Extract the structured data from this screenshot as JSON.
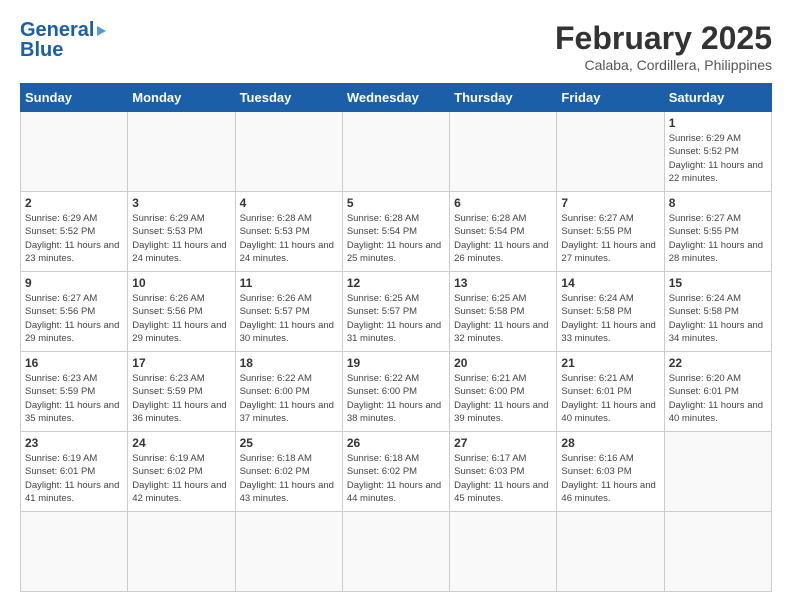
{
  "logo": {
    "general": "General",
    "blue": "Blue"
  },
  "title": "February 2025",
  "subtitle": "Calaba, Cordillera, Philippines",
  "weekdays": [
    "Sunday",
    "Monday",
    "Tuesday",
    "Wednesday",
    "Thursday",
    "Friday",
    "Saturday"
  ],
  "days": [
    {
      "date": null,
      "info": null
    },
    {
      "date": null,
      "info": null
    },
    {
      "date": null,
      "info": null
    },
    {
      "date": null,
      "info": null
    },
    {
      "date": null,
      "info": null
    },
    {
      "date": null,
      "info": null
    },
    {
      "date": "1",
      "info": "Sunrise: 6:29 AM\nSunset: 5:52 PM\nDaylight: 11 hours and 22 minutes."
    },
    {
      "date": "2",
      "info": "Sunrise: 6:29 AM\nSunset: 5:52 PM\nDaylight: 11 hours and 23 minutes."
    },
    {
      "date": "3",
      "info": "Sunrise: 6:29 AM\nSunset: 5:53 PM\nDaylight: 11 hours and 24 minutes."
    },
    {
      "date": "4",
      "info": "Sunrise: 6:28 AM\nSunset: 5:53 PM\nDaylight: 11 hours and 24 minutes."
    },
    {
      "date": "5",
      "info": "Sunrise: 6:28 AM\nSunset: 5:54 PM\nDaylight: 11 hours and 25 minutes."
    },
    {
      "date": "6",
      "info": "Sunrise: 6:28 AM\nSunset: 5:54 PM\nDaylight: 11 hours and 26 minutes."
    },
    {
      "date": "7",
      "info": "Sunrise: 6:27 AM\nSunset: 5:55 PM\nDaylight: 11 hours and 27 minutes."
    },
    {
      "date": "8",
      "info": "Sunrise: 6:27 AM\nSunset: 5:55 PM\nDaylight: 11 hours and 28 minutes."
    },
    {
      "date": "9",
      "info": "Sunrise: 6:27 AM\nSunset: 5:56 PM\nDaylight: 11 hours and 29 minutes."
    },
    {
      "date": "10",
      "info": "Sunrise: 6:26 AM\nSunset: 5:56 PM\nDaylight: 11 hours and 29 minutes."
    },
    {
      "date": "11",
      "info": "Sunrise: 6:26 AM\nSunset: 5:57 PM\nDaylight: 11 hours and 30 minutes."
    },
    {
      "date": "12",
      "info": "Sunrise: 6:25 AM\nSunset: 5:57 PM\nDaylight: 11 hours and 31 minutes."
    },
    {
      "date": "13",
      "info": "Sunrise: 6:25 AM\nSunset: 5:58 PM\nDaylight: 11 hours and 32 minutes."
    },
    {
      "date": "14",
      "info": "Sunrise: 6:24 AM\nSunset: 5:58 PM\nDaylight: 11 hours and 33 minutes."
    },
    {
      "date": "15",
      "info": "Sunrise: 6:24 AM\nSunset: 5:58 PM\nDaylight: 11 hours and 34 minutes."
    },
    {
      "date": "16",
      "info": "Sunrise: 6:23 AM\nSunset: 5:59 PM\nDaylight: 11 hours and 35 minutes."
    },
    {
      "date": "17",
      "info": "Sunrise: 6:23 AM\nSunset: 5:59 PM\nDaylight: 11 hours and 36 minutes."
    },
    {
      "date": "18",
      "info": "Sunrise: 6:22 AM\nSunset: 6:00 PM\nDaylight: 11 hours and 37 minutes."
    },
    {
      "date": "19",
      "info": "Sunrise: 6:22 AM\nSunset: 6:00 PM\nDaylight: 11 hours and 38 minutes."
    },
    {
      "date": "20",
      "info": "Sunrise: 6:21 AM\nSunset: 6:00 PM\nDaylight: 11 hours and 39 minutes."
    },
    {
      "date": "21",
      "info": "Sunrise: 6:21 AM\nSunset: 6:01 PM\nDaylight: 11 hours and 40 minutes."
    },
    {
      "date": "22",
      "info": "Sunrise: 6:20 AM\nSunset: 6:01 PM\nDaylight: 11 hours and 40 minutes."
    },
    {
      "date": "23",
      "info": "Sunrise: 6:19 AM\nSunset: 6:01 PM\nDaylight: 11 hours and 41 minutes."
    },
    {
      "date": "24",
      "info": "Sunrise: 6:19 AM\nSunset: 6:02 PM\nDaylight: 11 hours and 42 minutes."
    },
    {
      "date": "25",
      "info": "Sunrise: 6:18 AM\nSunset: 6:02 PM\nDaylight: 11 hours and 43 minutes."
    },
    {
      "date": "26",
      "info": "Sunrise: 6:18 AM\nSunset: 6:02 PM\nDaylight: 11 hours and 44 minutes."
    },
    {
      "date": "27",
      "info": "Sunrise: 6:17 AM\nSunset: 6:03 PM\nDaylight: 11 hours and 45 minutes."
    },
    {
      "date": "28",
      "info": "Sunrise: 6:16 AM\nSunset: 6:03 PM\nDaylight: 11 hours and 46 minutes."
    },
    {
      "date": null,
      "info": null
    },
    {
      "date": null,
      "info": null
    },
    {
      "date": null,
      "info": null
    },
    {
      "date": null,
      "info": null
    },
    {
      "date": null,
      "info": null
    },
    {
      "date": null,
      "info": null
    },
    {
      "date": null,
      "info": null
    }
  ]
}
